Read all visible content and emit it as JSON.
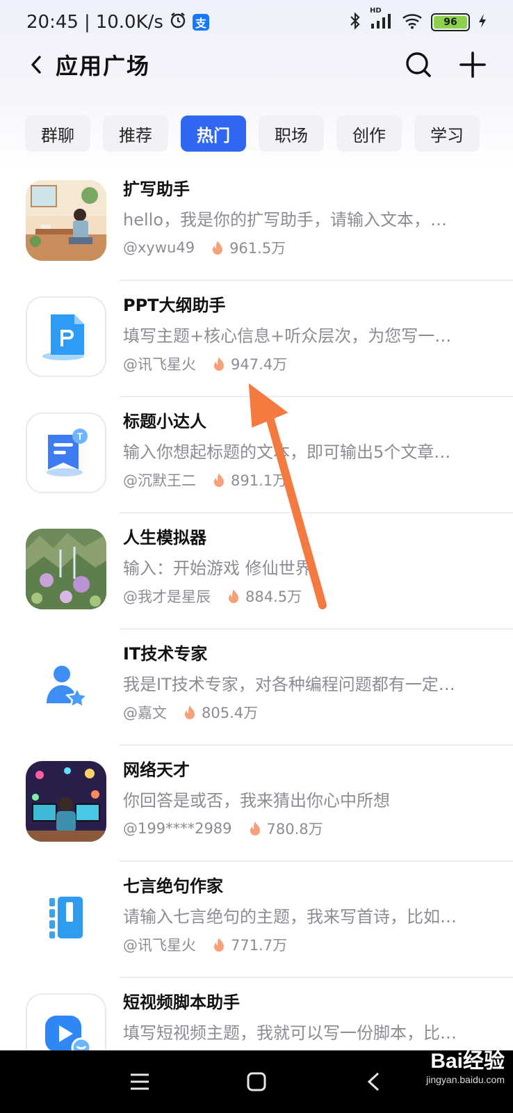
{
  "status_bar": {
    "time": "20:45",
    "network_speed": "10.0K/s",
    "battery_level": "96",
    "alipay_badge": "支",
    "hd_label": "HD"
  },
  "header": {
    "title": "应用广场"
  },
  "tabs": [
    {
      "label": "群聊",
      "active": false
    },
    {
      "label": "推荐",
      "active": false
    },
    {
      "label": "热门",
      "active": true
    },
    {
      "label": "职场",
      "active": false
    },
    {
      "label": "创作",
      "active": false
    },
    {
      "label": "学习",
      "active": false
    }
  ],
  "apps": [
    {
      "name": "扩写助手",
      "desc": "hello，我是你的扩写助手，请输入文本，…",
      "author": "@xywu49",
      "heat": "961.5万",
      "icon": "illustration-reading-man"
    },
    {
      "name": "PPT大纲助手",
      "desc": "填写主题+核心信息+听众层次，为您写一…",
      "author": "@讯飞星火",
      "heat": "947.4万",
      "icon": "ppt-document-icon"
    },
    {
      "name": "标题小达人",
      "desc": "输入你想起标题的文本，即可输出5个文章…",
      "author": "@沉默王二",
      "heat": "891.1万",
      "icon": "title-bookmark-icon"
    },
    {
      "name": "人生模拟器",
      "desc": "输入：开始游戏 修仙世界",
      "author": "@我才是星辰",
      "heat": "884.5万",
      "icon": "fantasy-landscape-image"
    },
    {
      "name": "IT技术专家",
      "desc": "我是IT技术专家，对各种编程问题都有一定…",
      "author": "@嘉文",
      "heat": "805.4万",
      "icon": "expert-user-star-icon"
    },
    {
      "name": "网络天才",
      "desc": "你回答是或否，我来猜出你心中所想",
      "author": "@199****2989",
      "heat": "780.8万",
      "icon": "cyber-genius-image"
    },
    {
      "name": "七言绝句作家",
      "desc": "请输入七言绝句的主题，我来写首诗，比如…",
      "author": "@讯飞星火",
      "heat": "771.7万",
      "icon": "poem-book-icon"
    },
    {
      "name": "短视频脚本助手",
      "desc": "填写短视频主题，我就可以写一份脚本，比…",
      "author": "",
      "heat": "",
      "icon": "video-play-icon"
    }
  ],
  "watermark": {
    "brand": "Bai经验",
    "url": "jingyan.baidu.com"
  },
  "colors": {
    "accent": "#2f67f2",
    "arrow": "#f47a3f",
    "fire": "#f7a07a"
  }
}
